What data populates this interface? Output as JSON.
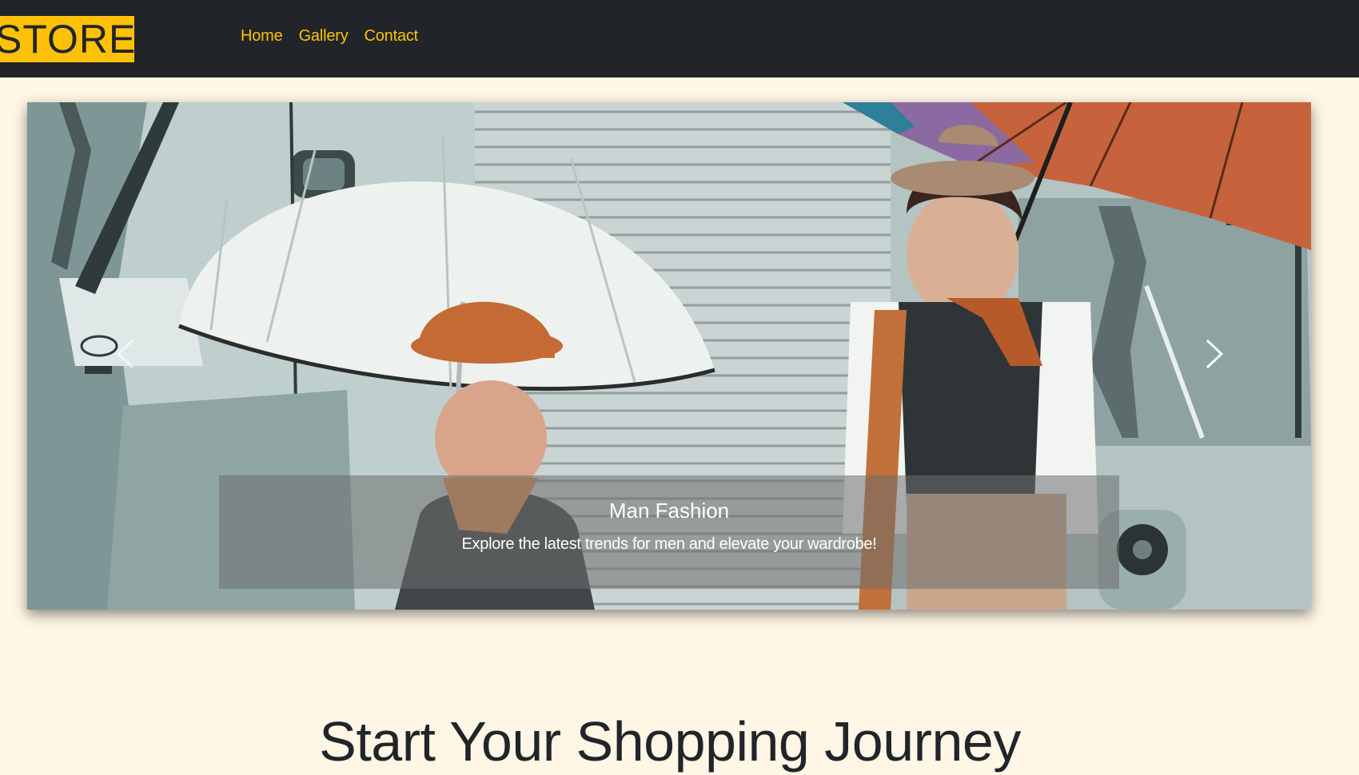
{
  "brand": {
    "logo_text": "STORE",
    "colors": {
      "navbar_bg": "#212529",
      "accent": "#ffc107",
      "page_bg": "#fff6e5"
    }
  },
  "nav": {
    "items": [
      {
        "label": "Home"
      },
      {
        "label": "Gallery"
      },
      {
        "label": "Contact"
      }
    ]
  },
  "carousel": {
    "slide": {
      "title": "Man Fashion",
      "text": "Explore the latest trends for men and elevate your wardrobe!"
    },
    "prev_icon": "chevron-left-icon",
    "next_icon": "chevron-right-icon"
  },
  "main": {
    "heading": "Start Your Shopping Journey"
  }
}
